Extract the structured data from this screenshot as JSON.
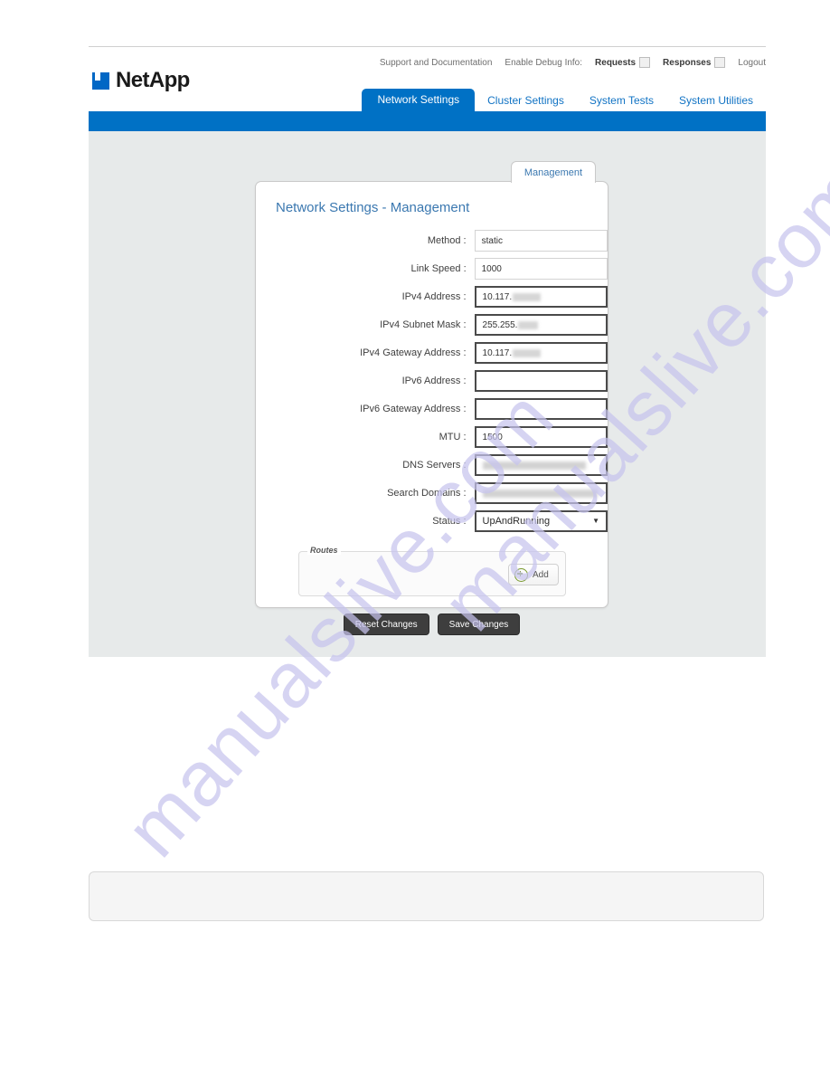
{
  "watermark": {
    "line1": "manualslive.com",
    "line2": "manualslive.com",
    "color": "#c7c4ee"
  },
  "brand": {
    "name": "NetApp",
    "logo_icon": "netapp-logo-icon",
    "accent_color": "#0071c5"
  },
  "utility": {
    "support_link": "Support and Documentation",
    "debug_label": "Enable Debug Info:",
    "requests_label": "Requests",
    "requests_checked": false,
    "responses_label": "Responses",
    "responses_checked": false,
    "logout_label": "Logout"
  },
  "nav": {
    "tabs": [
      {
        "label": "Network Settings",
        "active": true
      },
      {
        "label": "Cluster Settings",
        "active": false
      },
      {
        "label": "System Tests",
        "active": false
      },
      {
        "label": "System Utilities",
        "active": false
      }
    ]
  },
  "panel": {
    "tab_label": "Management",
    "title": "Network Settings - Management",
    "fields": [
      {
        "label": "Method :",
        "value": "static",
        "editable": false,
        "redacted": ""
      },
      {
        "label": "Link Speed :",
        "value": "1000",
        "editable": false,
        "redacted": ""
      },
      {
        "label": "IPv4 Address :",
        "value": "10.117.",
        "editable": true,
        "redacted": "XXX.XXX"
      },
      {
        "label": "IPv4 Subnet Mask :",
        "value": "255.255.",
        "editable": true,
        "redacted": "XXX.X"
      },
      {
        "label": "IPv4 Gateway Address :",
        "value": "10.117.",
        "editable": true,
        "redacted": "XXX.XXX"
      },
      {
        "label": "IPv6 Address :",
        "value": "",
        "editable": true,
        "redacted": ""
      },
      {
        "label": "IPv6 Gateway Address :",
        "value": "",
        "editable": true,
        "redacted": ""
      },
      {
        "label": "MTU :",
        "value": "1500",
        "editable": true,
        "redacted": ""
      },
      {
        "label": "DNS Servers :",
        "value": "",
        "editable": true,
        "redacted": "XX.XXX.XX.XX, XX.XX.XXX.XX"
      },
      {
        "label": "Search Domains :",
        "value": "",
        "editable": true,
        "redacted": "xxx.xxxxxx.xxx.xxx.xxx.xxxxxx"
      }
    ],
    "status": {
      "label": "Status :",
      "value": "UpAndRunning",
      "caret_icon": "chevron-down-icon"
    },
    "routes": {
      "legend": "Routes",
      "add_label": "Add",
      "add_icon": "plus-circle-icon"
    },
    "actions": {
      "reset_label": "Reset Changes",
      "save_label": "Save Changes"
    }
  }
}
